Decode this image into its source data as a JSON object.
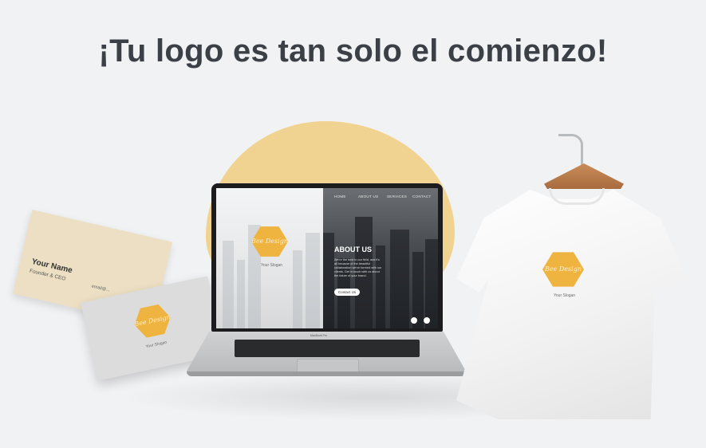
{
  "headline": "¡Tu logo es tan solo el comienzo!",
  "business_card": {
    "name": "Your Name",
    "role": "Founder & CEO",
    "email": "email@..."
  },
  "logo": {
    "script_text": "Bee Design",
    "caption": "Your Slogan"
  },
  "website": {
    "nav": [
      "HOME",
      "ABOUT US",
      "SERVICES",
      "CONTACT"
    ],
    "about_title": "ABOUT US",
    "about_body": "We're the best in our field, and it's all because of the beautiful collaboration we've formed with our clients. Get in touch with us about the future of your brand.",
    "contact_button": "Contact Us",
    "social_icons": [
      "facebook-icon",
      "twitter-icon"
    ]
  },
  "laptop_label": "MacBook Pro",
  "colors": {
    "accent_yellow": "#efb33f",
    "blob": "#f1d391",
    "headline": "#3b4047",
    "background": "#f1f2f4"
  }
}
